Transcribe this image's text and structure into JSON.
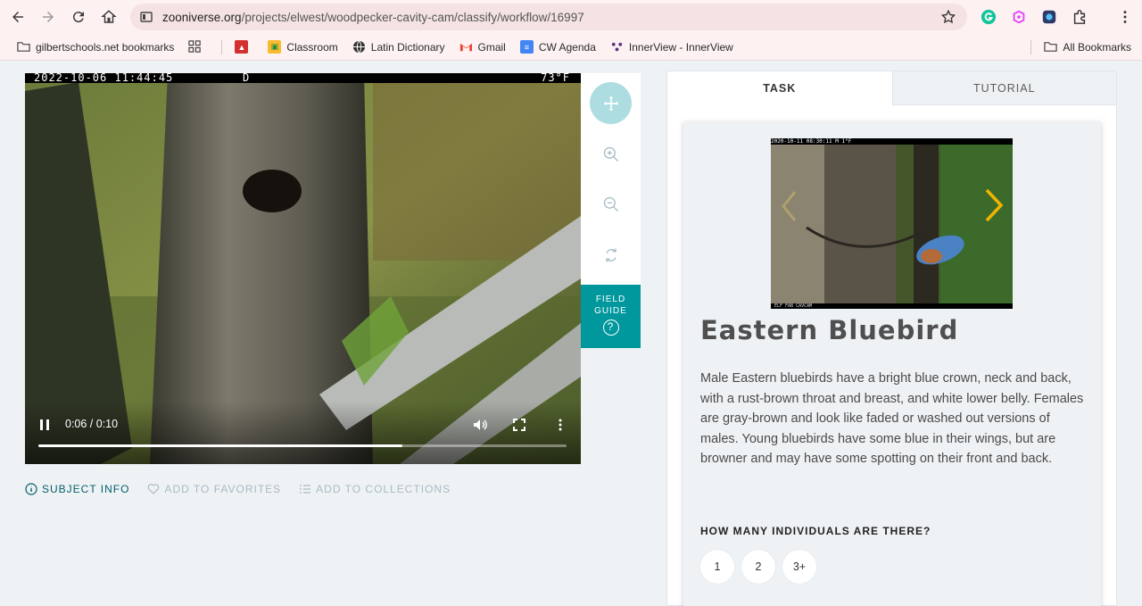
{
  "browser": {
    "url_host": "zooniverse.org",
    "url_path": "/projects/elwest/woodpecker-cavity-cam/classify/workflow/16997"
  },
  "bookmarks": {
    "items": [
      {
        "label": "gilbertschools.net bookmarks"
      },
      {
        "label": "Classroom"
      },
      {
        "label": "Latin Dictionary"
      },
      {
        "label": "Gmail"
      },
      {
        "label": "CW Agenda"
      },
      {
        "label": "InnerView - InnerView"
      }
    ],
    "all_label": "All Bookmarks"
  },
  "video": {
    "stamp_date": "2022-10-06 11:44:45",
    "stamp_cam": "D",
    "stamp_temp": "73°F",
    "time": "0:06 / 0:10",
    "progress": 0.69
  },
  "tools": {
    "field_guide_label_1": "FIELD",
    "field_guide_label_2": "GUIDE",
    "field_guide_icon": "?"
  },
  "meta": {
    "subject_info": "SUBJECT INFO",
    "favorites": "ADD TO FAVORITES",
    "collections": "ADD TO COLLECTIONS"
  },
  "panel": {
    "tab_task": "TASK",
    "tab_tutorial": "TUTORIAL",
    "image_stamp": "2020-10-11 08:30:11   M 1°F",
    "image_footer": "ELF FAB CAVCAM",
    "species_name": "Eastern Bluebird",
    "description": "Male Eastern bluebirds have a bright blue crown, neck and back, with a rust-brown throat and breast, and white lower belly. Females are gray-brown and look like faded or washed out versions of males. Young bluebirds have some blue in their wings, but are browner and may have some spotting on their front and back.",
    "question": "HOW MANY INDIVIDUALS ARE THERE?",
    "answers": [
      "1",
      "2",
      "3+"
    ]
  }
}
